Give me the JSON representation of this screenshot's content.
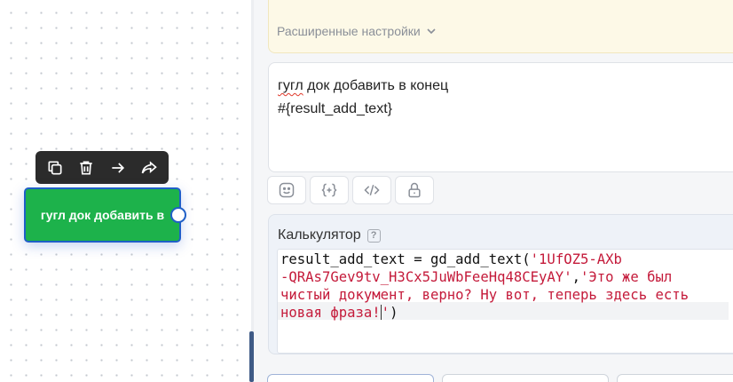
{
  "canvas": {
    "node": {
      "label": "гугл док добавить в",
      "color": "#1db24b",
      "border_color": "#1f5fc7"
    },
    "toolbar": {
      "icons": [
        "copy-icon",
        "trash-icon",
        "arrow-right-icon",
        "share-icon"
      ]
    }
  },
  "panel": {
    "advanced": {
      "label": "Расширенные настройки",
      "icon": "chevron-down-icon"
    },
    "message": {
      "word_misspelled": "гугл",
      "line1_rest": " док добавить в конец",
      "line2": "#{result_add_text}"
    },
    "tools": [
      "smiley-icon",
      "variable-braces-icon",
      "code-icon",
      "lock-icon"
    ],
    "calculator": {
      "title": "Калькулятор",
      "help": "?",
      "code": {
        "l1_plain": "result_add_text = gd_add_text(",
        "l1_str": "'1UfOZ5-AXb",
        "l2_str1": "-QRAs7Gev9tv_H3Cx5JuWbFeeHq48CEyAY'",
        "l2_comma": ",",
        "l2_str2": "'Это же был",
        "l3_str": "чистый документ, верно? Ну вот, теперь здесь есть",
        "l4_str_a": "новая фраза!",
        "l4_str_b": "'",
        "l4_close": ")"
      }
    }
  }
}
